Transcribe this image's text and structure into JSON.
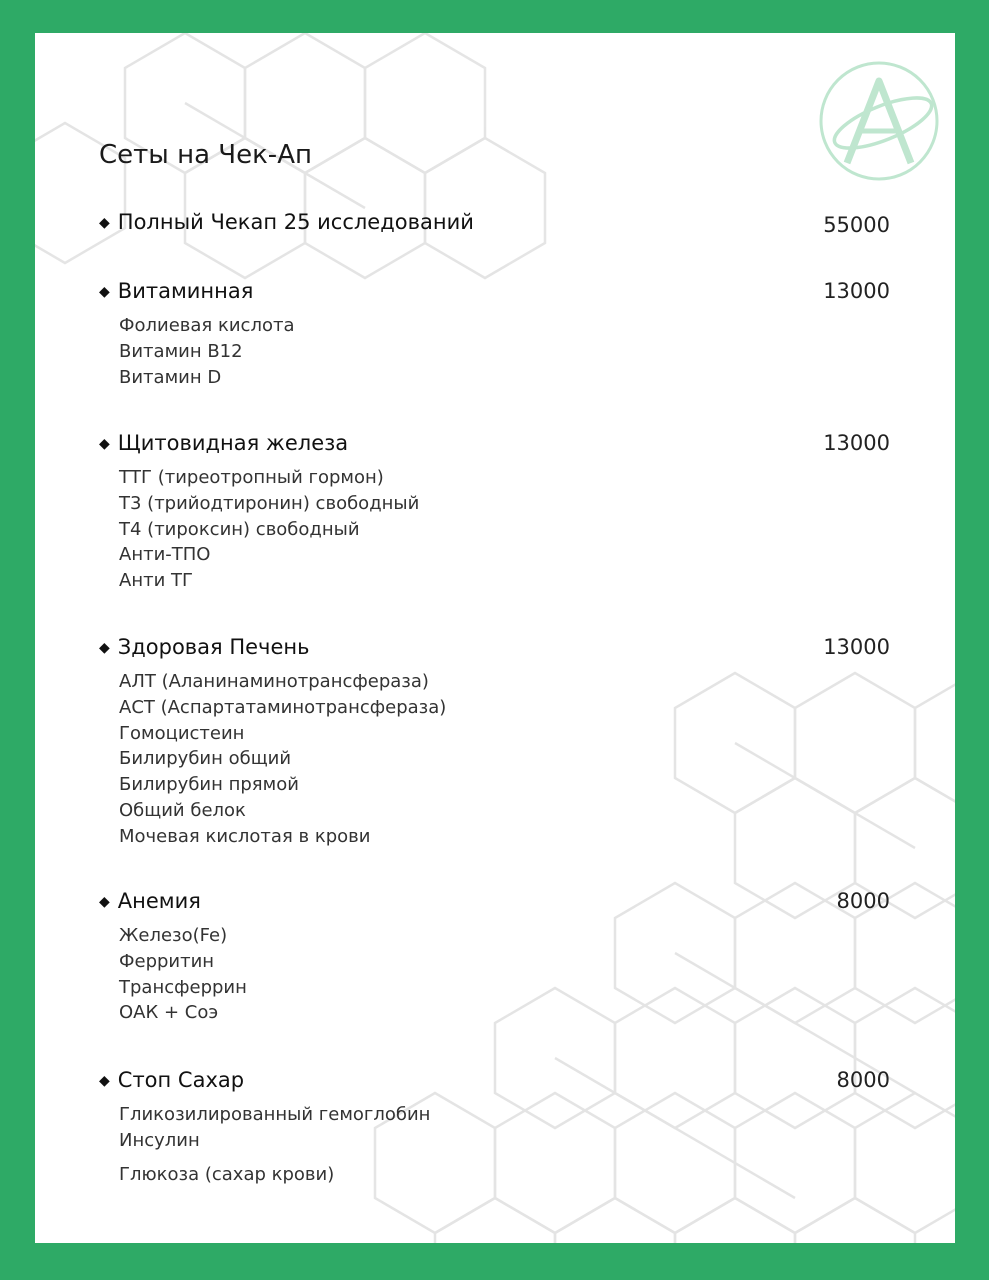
{
  "title": "Сеты на Чек-Ап",
  "sections": [
    {
      "name": "Полный Чекап 25 исследований",
      "price": "55000",
      "items": []
    },
    {
      "name": "Витаминная",
      "price": "13000",
      "items": [
        "Фолиевая кислота",
        "Витамин В12",
        "Витамин D"
      ]
    },
    {
      "name": "Щитовидная железа",
      "price": "13000",
      "items": [
        "ТТГ (тиреотропный гормон)",
        "Т3 (трийодтиронин) свободный",
        "Т4 (тироксин) свободный",
        "Анти-ТПО",
        "Анти ТГ"
      ]
    },
    {
      "name": "Здоровая Печень",
      "price": "13000",
      "items": [
        "АЛТ (Аланинаминотрансфераза)",
        "АСТ (Аспартатаминотрансфераза)",
        "Гомоцистеин",
        "Билирубин общий",
        "Билирубин прямой",
        "Общий белок",
        "Мочевая кислотая в крови"
      ]
    },
    {
      "name": "Анемия",
      "price": "8000",
      "items": [
        "Железо(Fe)",
        "Ферритин",
        "Трансферрин",
        "ОАК + Соэ"
      ]
    },
    {
      "name": "Стоп Сахар",
      "price": "8000",
      "items": [
        "Гликозилированный гемоглобин",
        "Инсулин",
        "Глюкоза (сахар крови)"
      ]
    }
  ],
  "colors": {
    "border": "#2eaa66",
    "logo": "#bfe6cf",
    "pattern": "#e3e3e3"
  },
  "icons": {
    "bullet": "diamond-bullet-icon",
    "logo": "clinic-logo-a-icon"
  }
}
